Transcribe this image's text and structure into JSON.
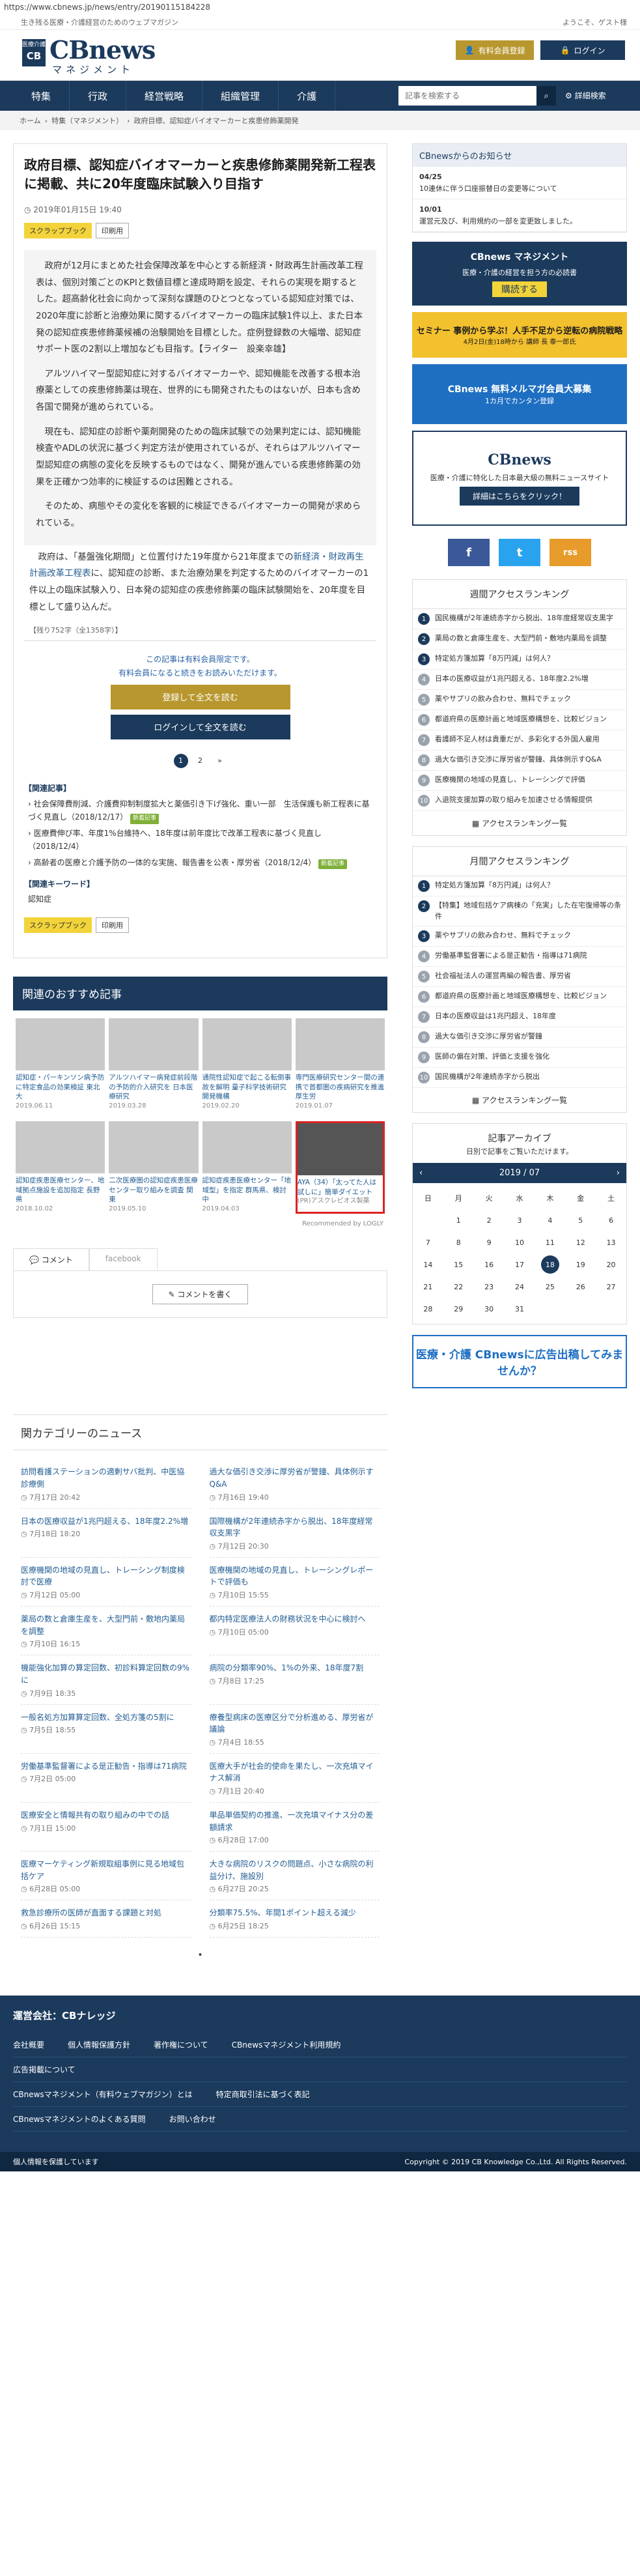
{
  "url": "https://www.cbnews.jp/news/entry/20190115184228",
  "tagline": "生き残る医療・介護経営のためのウェブマガジン",
  "welcome": "ようこそ、ゲスト様",
  "logo": {
    "box_top": "医療介護",
    "box_main": "CB",
    "brand": "CBnews",
    "sub": "マネジメント"
  },
  "header_buttons": {
    "paid": "有料会員登録",
    "login": "ログイン"
  },
  "nav": [
    "特集",
    "行政",
    "経営戦略",
    "組織管理",
    "介護"
  ],
  "search": {
    "placeholder": "記事を検索する",
    "advanced": "詳細検索"
  },
  "breadcrumb": [
    "ホーム",
    "特集（マネジメント）",
    "政府目標、認知症バイオマーカーと疾患修飾薬開発"
  ],
  "article": {
    "title": "政府目標、認知症バイオマーカーと疾患修飾薬開発新工程表に掲載、共に20年度臨床試験入り目指す",
    "date": "2019年01月15日 19:40",
    "scrap": "スクラップブック",
    "print": "印刷用",
    "p1": "政府が12月にまとめた社会保障改革を中心とする新経済・財政再生計画改革工程表は、個別対策ごとのKPIと数値目標と達成時期を設定、それらの実現を期するとした。超高齢化社会に向かって深刻な課題のひとつとなっている認知症対策では、2020年度に診断と治療効果に関するバイオマーカーの臨床試験1件以上、また日本発の認知症疾患修飾薬候補の治験開始を目標とした。症例登録数の大幅増、認知症サポート医の2割以上増加なども目指す。【ライター　設楽幸雄】",
    "p2": "アルツハイマー型認知症に対するバイオマーカーや、認知機能を改善する根本治療薬としての疾患修飾薬は現在、世界的にも開発されたものはないが、日本も含め各国で開発が進められている。",
    "p3": "現在も、認知症の診断や薬剤開発のための臨床試験での効果判定には、認知機能検査やADLの状況に基づく判定方法が使用されているが、それらはアルツハイマー型認知症の病態の変化を反映するものではなく、開発が進んでいる疾患修飾薬の効果を正確かつ効率的に検証するのは困難とされる。",
    "p4": "そのため、病態やその変化を客観的に検証できるバイオマーカーの開発が求められている。",
    "p5a": "政府は、「基盤強化期間」と位置付けた19年度から21年度までの",
    "p5link": "新経済・財政再生計画改革工程表",
    "p5b": "に、認知症の診断、また治療効果を判定するためのバイオマーカーの1件以上の臨床試験入り、日本発の認知症の疾患修飾薬の臨床試験開始を、20年度を目標として盛り込んだ。",
    "count": "【残り752字（全1358字）】",
    "member1": "この記事は有料会員限定です。",
    "member2": "有料会員になると続きをお読みいただけます。",
    "register": "登録して全文を読む",
    "login_read": "ログインして全文を読む",
    "pages": [
      "1",
      "2",
      "»"
    ],
    "related_head": "【関連記事】",
    "related": [
      {
        "t": "社会保障費削減、介護費抑制制度拡大と薬価引き下げ強化、重い一部　生活保護も新工程表に基づく見直し",
        "d": "（2018/12/17）",
        "new": "新着記事"
      },
      {
        "t": "医療費伸び率、年度1%台維持へ、18年度は前年度比で改革工程表に基づく見直し",
        "d": "（2018/12/4）",
        "new": ""
      },
      {
        "t": "高齢者の医療と介護予防の一体的な実施、報告書を公表・厚労省",
        "d": "（2018/12/4）",
        "new": "新着記事"
      }
    ],
    "kw_head": "【関連キーワード】",
    "kw": "認知症"
  },
  "recommend": {
    "title": "関連のおすすめ記事",
    "cards": [
      {
        "t": "認知症・パーキンソン病予防に特定食品の効果検証 東北大",
        "d": "2019.06.11"
      },
      {
        "t": "アルツハイマー病発症前段階の予防的介入研究を 日本医療研究",
        "d": "2019.03.28"
      },
      {
        "t": "通院性認知症で起こる転倒事故を解明 量子科学技術研究開発機構",
        "d": "2019.02.20"
      },
      {
        "t": "専門医療研究センター間の連携で首都圏の疾病研究を推進 厚生労",
        "d": "2019.01.07"
      },
      {
        "t": "認知症疾患医療センター、地域拠点施設を追加指定 長野県",
        "d": "2018.10.02"
      },
      {
        "t": "二次医療圏の認知症疾患医療センター取り組みを調査 関東",
        "d": "2019.05.10"
      },
      {
        "t": "認知症疾患医療センター「地域型」を指定 群馬県、検討中",
        "d": "2019.04.03"
      },
      {
        "t": "AYA（34）「太ってた人は試しに」簡単ダイエット",
        "d": "(PR)アスクレピオス製薬"
      }
    ],
    "source": "Recommended by LOGLY"
  },
  "comments": {
    "tab1": "コメント",
    "tab2": "facebook",
    "write": "コメントを書く"
  },
  "news": {
    "title": "関カテゴリーのニュース",
    "items": [
      {
        "t": "訪問看護ステーションの適剰サバ批判、中医協診療側",
        "d": "7月17日 20:42"
      },
      {
        "t": "過大な価引き交渉に厚労省が警鐘、具体例示すQ&A",
        "d": "7月16日 19:40"
      },
      {
        "t": "日本の医療収益が1兆円超える、18年度2.2%増",
        "d": "7月18日 18:20"
      },
      {
        "t": "国際機構が2年連続赤字から脱出、18年度経常収支黒字",
        "d": "7月12日 20:30"
      },
      {
        "t": "医療機関の地域の見直し、トレーシング制度検討で医療",
        "d": "7月12日 05:00"
      },
      {
        "t": "医療機関の地域の見直し、トレーシングレポートで評価も",
        "d": "7月10日 15:55"
      },
      {
        "t": "薬局の数と倉庫生産を、大型門前・敷地内薬局を調整",
        "d": "7月10日 16:15"
      },
      {
        "t": "都内特定医療法人の財務状況を中心に検討へ",
        "d": "7月10日 05:00"
      },
      {
        "t": "機能強化加算の算定回数、初診料算定回数の9%に",
        "d": "7月9日 18:35"
      },
      {
        "t": "病院の分類率90%、1%の外来、18年度7割",
        "d": "7月8日 17:25"
      },
      {
        "t": "一般名処方加算算定回数、全処方箋の5割に",
        "d": "7月5日 18:55"
      },
      {
        "t": "療養型病床の医療区分で分析進める、厚労省が議論",
        "d": "7月4日 18:55"
      },
      {
        "t": "労働基準監督署による是正勧告・指導は71病院",
        "d": "7月2日 05:00"
      },
      {
        "t": "医療大手が社会的使命を果たし、一次充填マイナス解消",
        "d": "7月1日 20:40"
      },
      {
        "t": "医療安全と情報共有の取り組みの中での話",
        "d": "7月1日 15:00"
      },
      {
        "t": "単品単価契約の推進、一次充填マイナス分の差額請求",
        "d": "6月28日 17:00"
      },
      {
        "t": "医療マーケティング新規取組事例に見る地域包括ケア",
        "d": "6月28日 05:00"
      },
      {
        "t": "大きな病院のリスクの問題点、小さな病院の利益分け、施設別",
        "d": "6月27日 20:25"
      },
      {
        "t": "救急診療所の医師が直面する課題と対処",
        "d": "6月26日 15:15"
      },
      {
        "t": "分類率75.5%、年間1ポイント超える減少",
        "d": "6月25日 18:25"
      }
    ],
    "dot": "•"
  },
  "sidebar": {
    "notice_head": "CBnewsからのお知らせ",
    "notices": [
      {
        "d": "04/25",
        "t": "10連休に伴う口座振替日の変更等について"
      },
      {
        "d": "10/01",
        "t": "運営元及び、利用規約の一部を変更致しました。"
      }
    ],
    "ad1_title": "CBnews マネジメント",
    "ad1_text": "医療・介護の経営を担う方の必読書",
    "ad1_cta": "購読する",
    "ad2_title": "セミナー 事例から学ぶ！人手不足から逆転の病院戦略",
    "ad2_sub": "4月2日(金)18時から 講師 長 泰一郎氏",
    "ad3_title": "CBnews 無料メルマガ会員大募集",
    "ad3_sub": "1カ月でカンタン登録",
    "ad4_title": "CBnews",
    "ad4_text": "医療・介護に特化した日本最大級の無料ニュースサイト",
    "ad4_cta": "詳細はこちらをクリック！",
    "social": [
      "f",
      "t",
      "rss"
    ],
    "weekly_head": "週間アクセスランキング",
    "weekly": [
      "国民機構が2年連続赤字から脱出、18年度経常収支黒字",
      "薬局の数と倉庫生産を、大型門前・敷地内薬局を調整",
      "特定処方箋加算「8万円減」は何人？",
      "日本の医療収益が1兆円超える、18年度2.2%増",
      "薬やサプリの飲み合わせ、無料でチェック",
      "都道府県の医療計画と地域医療構想を、比較ビジョン",
      "看護師不足人材は貴重だが、多彩化する外国人雇用",
      "過大な価引き交渉に厚労省が警鐘、具体例示すQ&A",
      "医療機関の地域の見直し、トレーシングで評価",
      "入退院支援加算の取り組みを加速させる情報提供"
    ],
    "weekly_more": "アクセスランキング一覧",
    "monthly_head": "月間アクセスランキング",
    "monthly": [
      "特定処方箋加算「8万円減」は何人？",
      "【特集】地域包括ケア病棟の「充実」した在宅復帰等の条件",
      "薬やサプリの飲み合わせ、無料でチェック",
      "労働基準監督署による是正勧告・指導は71病院",
      "社会福祉法人の運営再編の報告書、厚労省",
      "都道府県の医療計画と地域医療構想を、比較ビジョン",
      "日本の医療収益は1兆円超え、18年度",
      "過大な価引き交渉に厚労省が警鐘",
      "医師の偏在対策、評価と支援を強化",
      "国民機構が2年連続赤字から脱出"
    ],
    "monthly_more": "アクセスランキング一覧",
    "archive_head": "記事アーカイブ",
    "archive_sub": "日別で記事をご覧いただけます。",
    "month": "2019 / 07",
    "dow": [
      "日",
      "月",
      "火",
      "水",
      "木",
      "金",
      "土"
    ],
    "days": [
      "",
      "1",
      "2",
      "3",
      "4",
      "5",
      "6",
      "7",
      "8",
      "9",
      "10",
      "11",
      "12",
      "13",
      "14",
      "15",
      "16",
      "17",
      "18",
      "19",
      "20",
      "21",
      "22",
      "23",
      "24",
      "25",
      "26",
      "27",
      "28",
      "29",
      "30",
      "31",
      "",
      "",
      ""
    ],
    "selected": "18",
    "ad5_title": "医療・介護 CBnewsに広告出稿してみませんか？"
  },
  "footer": {
    "title": "運営会社：CBナレッジ",
    "row1": [
      "会社概要",
      "個人情報保護方針",
      "著作権について",
      "CBnewsマネジメント利用規約"
    ],
    "row2": [
      "広告掲載について"
    ],
    "row3": [
      "CBnewsマネジメント（有料ウェブマガジン）とは",
      "特定商取引法に基づく表記"
    ],
    "row4": [
      "CBnewsマネジメントのよくある質問",
      "お問い合わせ"
    ],
    "privacy": "個人情報を保護しています",
    "copyright": "Copyright © 2019 CB Knowledge Co.,Ltd. All Rights Reserved."
  }
}
